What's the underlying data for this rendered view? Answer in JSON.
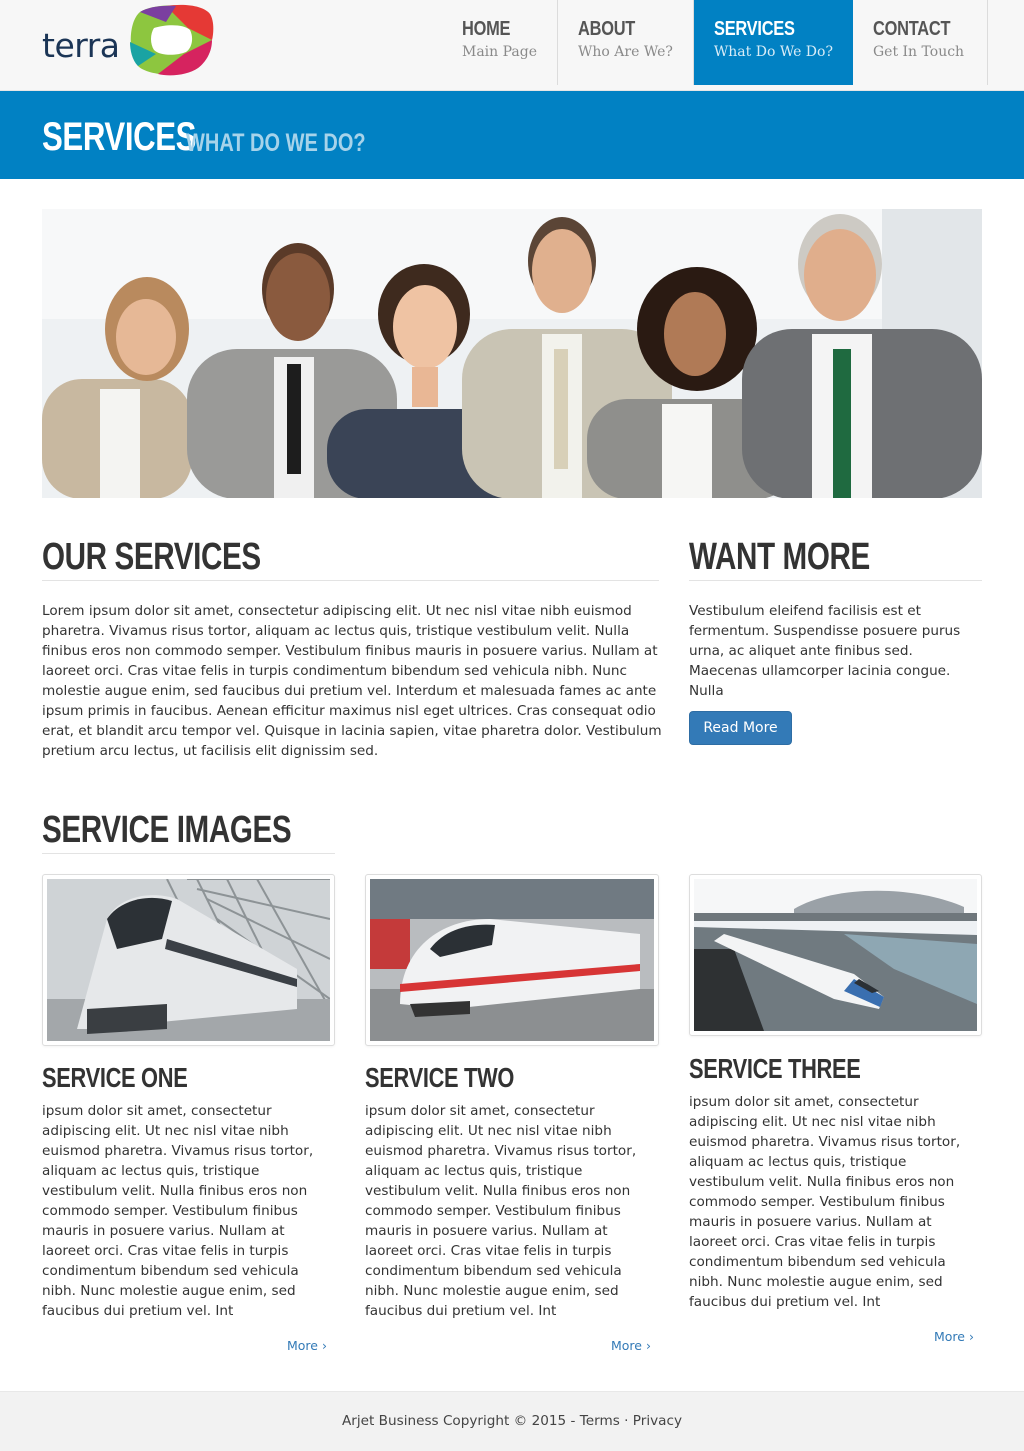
{
  "brand": {
    "name": "terra"
  },
  "nav": [
    {
      "title": "Home",
      "sub": "Main Page"
    },
    {
      "title": "About",
      "sub": "Who Are We?"
    },
    {
      "title": "Services",
      "sub": "What Do We Do?"
    },
    {
      "title": "Contact",
      "sub": "Get In Touch"
    }
  ],
  "page_title": {
    "main": "SERVICES",
    "sub": "WHAT DO WE DO?"
  },
  "our_services": {
    "heading": "OUR SERVICES",
    "text": "Lorem ipsum dolor sit amet, consectetur adipiscing elit. Ut nec nisl vitae nibh euismod pharetra. Vivamus risus tortor, aliquam ac lectus quis, tristique vestibulum velit. Nulla finibus eros non commodo semper. Vestibulum finibus mauris in posuere varius. Nullam at laoreet orci. Cras vitae felis in turpis condimentum bibendum sed vehicula nibh. Nunc molestie augue enim, sed faucibus dui pretium vel. Interdum et malesuada fames ac ante ipsum primis in faucibus. Aenean efficitur maximus nisl eget ultrices. Cras consequat odio erat, et blandit arcu tempor vel. Quisque in lacinia sapien, vitae pharetra dolor. Vestibulum pretium arcu lectus, ut facilisis elit dignissim sed."
  },
  "want_more": {
    "heading": "WANT MORE",
    "text": "Vestibulum eleifend facilisis est et fermentum. Suspendisse posuere purus urna, ac aliquet ante finibus sed. Maecenas ullamcorper lacinia congue. Nulla",
    "button": "Read More"
  },
  "service_images": {
    "heading": "SERVICE IMAGES",
    "items": [
      {
        "title": "SERVICE ONE",
        "text": "ipsum dolor sit amet, consectetur adipiscing elit. Ut nec nisl vitae nibh euismod pharetra. Vivamus risus tortor, aliquam ac lectus quis, tristique vestibulum velit. Nulla finibus eros non commodo semper. Vestibulum finibus mauris in posuere varius. Nullam at laoreet orci. Cras vitae felis in turpis condimentum bibendum sed vehicula nibh. Nunc molestie augue enim, sed faucibus dui pretium vel. Int",
        "more": "More ›"
      },
      {
        "title": "SERVICE TWO",
        "text": "ipsum dolor sit amet, consectetur adipiscing elit. Ut nec nisl vitae nibh euismod pharetra. Vivamus risus tortor, aliquam ac lectus quis, tristique vestibulum velit. Nulla finibus eros non commodo semper. Vestibulum finibus mauris in posuere varius. Nullam at laoreet orci. Cras vitae felis in turpis condimentum bibendum sed vehicula nibh. Nunc molestie augue enim, sed faucibus dui pretium vel. Int",
        "more": "More ›"
      },
      {
        "title": "SERVICE THREE",
        "text": "ipsum dolor sit amet, consectetur adipiscing elit. Ut nec nisl vitae nibh euismod pharetra. Vivamus risus tortor, aliquam ac lectus quis, tristique vestibulum velit. Nulla finibus eros non commodo semper. Vestibulum finibus mauris in posuere varius. Nullam at laoreet orci. Cras vitae felis in turpis condimentum bibendum sed vehicula nibh. Nunc molestie augue enim, sed faucibus dui pretium vel. Int",
        "more": "More ›"
      }
    ]
  },
  "footer": {
    "copyright": "Arjet Business Copyright © 2015",
    "sep1": " - ",
    "terms": "Terms",
    "sep2": " · ",
    "privacy": "Privacy"
  },
  "colors": {
    "primary": "#0181c3",
    "button": "#337ab7",
    "link": "#337ab7"
  }
}
